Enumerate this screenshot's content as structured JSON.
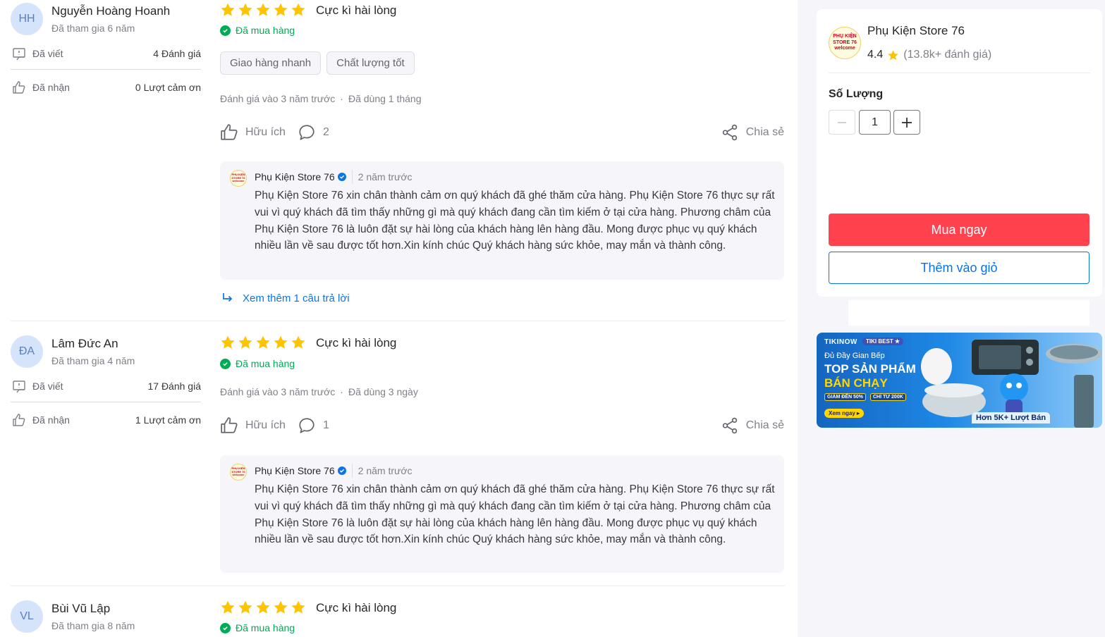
{
  "reviews": [
    {
      "avatar_initials": "HH",
      "name": "Nguyễn Hoàng Hoanh",
      "joined": "Đã tham gia 6 năm",
      "written_label": "Đã viết",
      "written_value": "4 Đánh giá",
      "received_label": "Đã nhận",
      "received_value": "0 Lượt cảm ơn",
      "rating": 5,
      "title": "Cực kì hài lòng",
      "bought": "Đã mua hàng",
      "chips": [
        "Giao hàng nhanh",
        "Chất lượng tốt"
      ],
      "reviewed_at": "Đánh giá vào 3 năm trước",
      "used_for": "Đã dùng 1 tháng",
      "helpful_label": "Hữu ích",
      "comment_count": "2",
      "share_label": "Chia sẻ",
      "reply": {
        "shop_name": "Phụ Kiện Store 76",
        "time": "2 năm trước",
        "text": "Phụ Kiện Store 76 xin chân thành cảm ơn quý khách đã ghé thăm cửa hàng. Phụ Kiện Store 76 thực sự rất vui vì quý khách đã tìm thấy những gì mà quý khách đang cần tìm kiếm ở tại cửa hàng. Phương châm của Phụ Kiện Store 76 là luôn đặt sự hài lòng của khách hàng lên hàng đầu. Mong được phục vụ quý khách nhiều lần về sau được tốt hơn.Xin kính chúc Quý khách hàng sức khỏe, may mắn và thành công."
      },
      "more_replies": "Xem thêm 1 câu trả lời"
    },
    {
      "avatar_initials": "ĐA",
      "name": "Lâm Đức An",
      "joined": "Đã tham gia 4 năm",
      "written_label": "Đã viết",
      "written_value": "17 Đánh giá",
      "received_label": "Đã nhận",
      "received_value": "1 Lượt cảm ơn",
      "rating": 5,
      "title": "Cực kì hài lòng",
      "bought": "Đã mua hàng",
      "reviewed_at": "Đánh giá vào 3 năm trước",
      "used_for": "Đã dùng 3 ngày",
      "helpful_label": "Hữu ích",
      "comment_count": "1",
      "share_label": "Chia sẻ",
      "reply": {
        "shop_name": "Phụ Kiện Store 76",
        "time": "2 năm trước",
        "text": "Phụ Kiện Store 76 xin chân thành cảm ơn quý khách đã ghé thăm cửa hàng. Phụ Kiện Store 76 thực sự rất vui vì quý khách đã tìm thấy những gì mà quý khách đang cần tìm kiếm ở tại cửa hàng. Phương châm của Phụ Kiện Store 76 là luôn đặt sự hài lòng của khách hàng lên hàng đầu. Mong được phục vụ quý khách nhiều lần về sau được tốt hơn.Xin kính chúc Quý khách hàng sức khỏe, may mắn và thành công."
      }
    },
    {
      "avatar_initials": "VL",
      "name": "Bùi Vũ Lập",
      "joined": "Đã tham gia 8 năm",
      "rating": 5,
      "title": "Cực kì hài lòng",
      "bought": "Đã mua hàng"
    }
  ],
  "sidebar": {
    "shop_logo_text": "PHỤ KIỆN STORE 76 welcome",
    "shop_name": "Phụ Kiện Store 76",
    "rating": "4.4",
    "rating_count": "(13.8k+ đánh giá)",
    "quantity_label": "Số Lượng",
    "quantity_value": "1",
    "buy_now": "Mua ngay",
    "add_to_cart": "Thêm vào giỏ"
  },
  "banner": {
    "brand": "TIKINOW",
    "badge": "TIKI BEST ★",
    "subtitle": "Đủ Đầy Gian Bếp",
    "headline_1": "TOP SẢN PHẨM",
    "headline_2": "BÁN CHẠY",
    "tag_1": "GIẢM ĐẾN 50%",
    "tag_2": "CHỈ TỪ 200K",
    "cta": "Xem ngay ▸",
    "sold": "Hơn 5K+ Lượt Bán"
  },
  "colors": {
    "star": "#ffc400",
    "bought": "#00ab56",
    "link": "#0b74e5",
    "buy": "#ff424e"
  }
}
